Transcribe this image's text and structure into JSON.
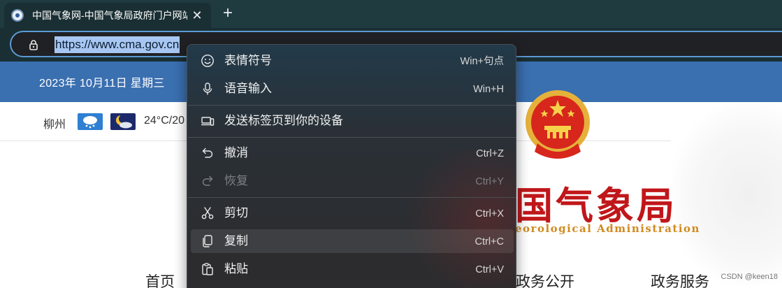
{
  "browser": {
    "tab_title": "中国气象网-中国气象局政府门户网站",
    "tab_close": "✕",
    "new_tab": "+",
    "url": "https://www.cma.gov.cn"
  },
  "page": {
    "date": "2023年  10月11日  星期三",
    "city": "柳州",
    "temperature": "24°C/20",
    "emblem_alt": "national-emblem",
    "title": "国气象局",
    "subtitle": "eorological Administration",
    "nav": {
      "home": "首页",
      "open": "政务公开",
      "service": "政务服务"
    },
    "watermark": "CSDN @keen18",
    "colors": {
      "topbar": "#3a6fb0",
      "title_red": "#c0171a",
      "subtitle_gold": "#d08a1f"
    }
  },
  "context_menu": {
    "items": [
      {
        "label": "表情符号",
        "shortcut": "Win+句点",
        "icon": "emoji-icon",
        "enabled": true
      },
      {
        "label": "语音输入",
        "shortcut": "Win+H",
        "icon": "microphone-icon",
        "enabled": true
      },
      {
        "label": "发送标签页到你的设备",
        "shortcut": "",
        "icon": "send-to-devices-icon",
        "enabled": true
      },
      {
        "label": "撤消",
        "shortcut": "Ctrl+Z",
        "icon": "undo-icon",
        "enabled": true
      },
      {
        "label": "恢复",
        "shortcut": "Ctrl+Y",
        "icon": "redo-icon",
        "enabled": false
      },
      {
        "label": "剪切",
        "shortcut": "Ctrl+X",
        "icon": "scissors-icon",
        "enabled": true
      },
      {
        "label": "复制",
        "shortcut": "Ctrl+C",
        "icon": "copy-icon",
        "enabled": true,
        "highlighted": true
      },
      {
        "label": "粘贴",
        "shortcut": "Ctrl+V",
        "icon": "paste-icon",
        "enabled": true
      }
    ]
  }
}
